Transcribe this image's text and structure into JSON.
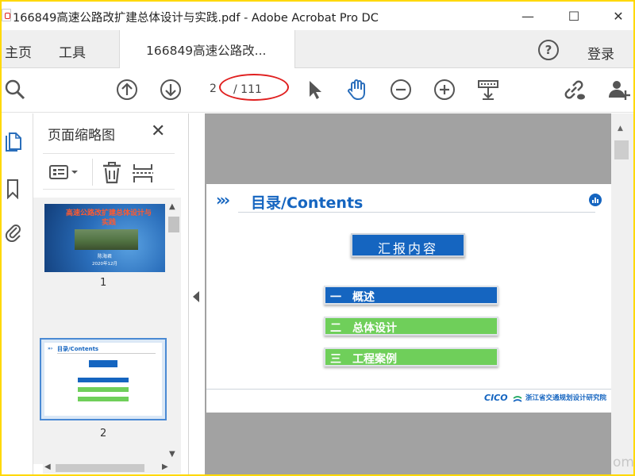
{
  "window": {
    "title": "166849高速公路改扩建总体设计与实践.pdf - Adobe Acrobat Pro DC",
    "minimize_glyph": "—",
    "maximize_glyph": "☐",
    "close_glyph": "✕"
  },
  "tabs": {
    "home": "主页",
    "tools": "工具",
    "document": "166849高速公路改...",
    "help_glyph": "?",
    "sign_in": "登录"
  },
  "toolbar": {
    "current_page": "2",
    "total_pages": "/ 111",
    "icons": [
      "search-icon",
      "page-up-icon",
      "page-down-icon",
      "select-arrow-icon",
      "hand-icon",
      "zoom-out-icon",
      "zoom-in-icon",
      "marquee-tool-icon",
      "share-link-icon",
      "add-user-icon"
    ],
    "annotation_color": "#e02020"
  },
  "thumbnails_panel": {
    "title": "页面缩略图",
    "close_glyph": "✕",
    "pages": [
      {
        "number": "1",
        "slide_title": "高速公路改扩建总体设计与实践",
        "slide_author": "陈海君",
        "slide_date": "2020年12月"
      },
      {
        "number": "2",
        "slide_title": "目录/Contents"
      }
    ]
  },
  "slide": {
    "header_marks": "»›",
    "title": "目录/Contents",
    "subtitle_box": "汇报内容",
    "items": [
      {
        "num": "一",
        "label": "概述",
        "color": "#1565c0"
      },
      {
        "num": "二",
        "label": "总体设计",
        "color": "#6fcf5a"
      },
      {
        "num": "三",
        "label": "工程案例",
        "color": "#6fcf5a"
      }
    ],
    "footer_logo": "CICO",
    "footer_org": "浙江省交通规划设计研究院"
  },
  "watermark_text": "om",
  "colors": {
    "brand_blue": "#1565c0",
    "acrobat_blue": "#2a6ebb",
    "frame_yellow": "#ffd800"
  }
}
